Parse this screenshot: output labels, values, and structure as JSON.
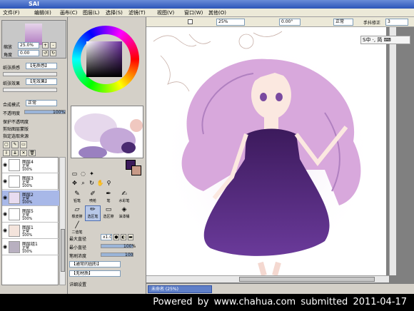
{
  "app": {
    "title": "SAI"
  },
  "menu": [
    "文件(F)",
    "编辑(E)",
    "画布(C)",
    "图层(L)",
    "选择(S)",
    "滤镜(T)",
    "视图(V)",
    "窗口(W)",
    "其他(O)"
  ],
  "toolbar": {
    "zoom_value": "25%",
    "angle_value": "0.00°",
    "mode_label": "正常",
    "stabilizer_label": "手抖修正",
    "stabilizer_value": "3"
  },
  "ime": {
    "text": "S中 ·, 简 ⌨"
  },
  "left_panel": {
    "zoom_label": "缩放",
    "zoom_value": "25.0%",
    "angle_label": "角度",
    "angle_value": "0.00",
    "paper_label": "纸张质感",
    "paper_value": "【无质感】",
    "effect_label": "纸张效果",
    "effect_value": "【无效果】",
    "blend_label": "合成模式",
    "blend_value": "正常",
    "opacity_label": "不透明度",
    "opacity_value": "100%",
    "check_protect": "保护不透明度",
    "check_clip": "剪贴图层蒙版",
    "check_select": "指定选取来源",
    "layers": [
      {
        "name": "图层4",
        "mode": "正常",
        "pct": "100%"
      },
      {
        "name": "图层3",
        "mode": "正常",
        "pct": "100%"
      },
      {
        "name": "图层2",
        "mode": "正常",
        "pct": "100%"
      },
      {
        "name": "图层5",
        "mode": "正常",
        "pct": "100%"
      },
      {
        "name": "图层1",
        "mode": "正常",
        "pct": "100%"
      },
      {
        "name": "图层组1",
        "mode": "正常",
        "pct": "100%"
      }
    ]
  },
  "tool_panel": {
    "tools": [
      {
        "label": "铅笔",
        "glyph": "✎"
      },
      {
        "label": "喷枪",
        "glyph": "✐"
      },
      {
        "label": "笔",
        "glyph": "✒"
      },
      {
        "label": "水彩笔",
        "glyph": "✍"
      },
      {
        "label": "橡皮擦",
        "glyph": "▱"
      },
      {
        "label": "选区笔",
        "glyph": "✏"
      },
      {
        "label": "选区擦",
        "glyph": "▭"
      },
      {
        "label": "油漆桶",
        "glyph": "◈"
      },
      {
        "label": "二值笔",
        "glyph": "╱"
      }
    ],
    "brush_size_label": "最大直径",
    "brush_size_value": "x1.0",
    "min_size_label": "最小直径",
    "min_size_value": "100%",
    "density_label": "笔刷浓度",
    "density_value": "100",
    "shape_label": "【通常的圆形】",
    "texture_label": "【无材质】",
    "detail_label": "详细设置"
  },
  "document": {
    "tab_label": "未命名 (25%)",
    "tab_pct": "25%"
  },
  "footer": {
    "text": "Powered by www.chahua.com submitted 2011-04-17"
  }
}
